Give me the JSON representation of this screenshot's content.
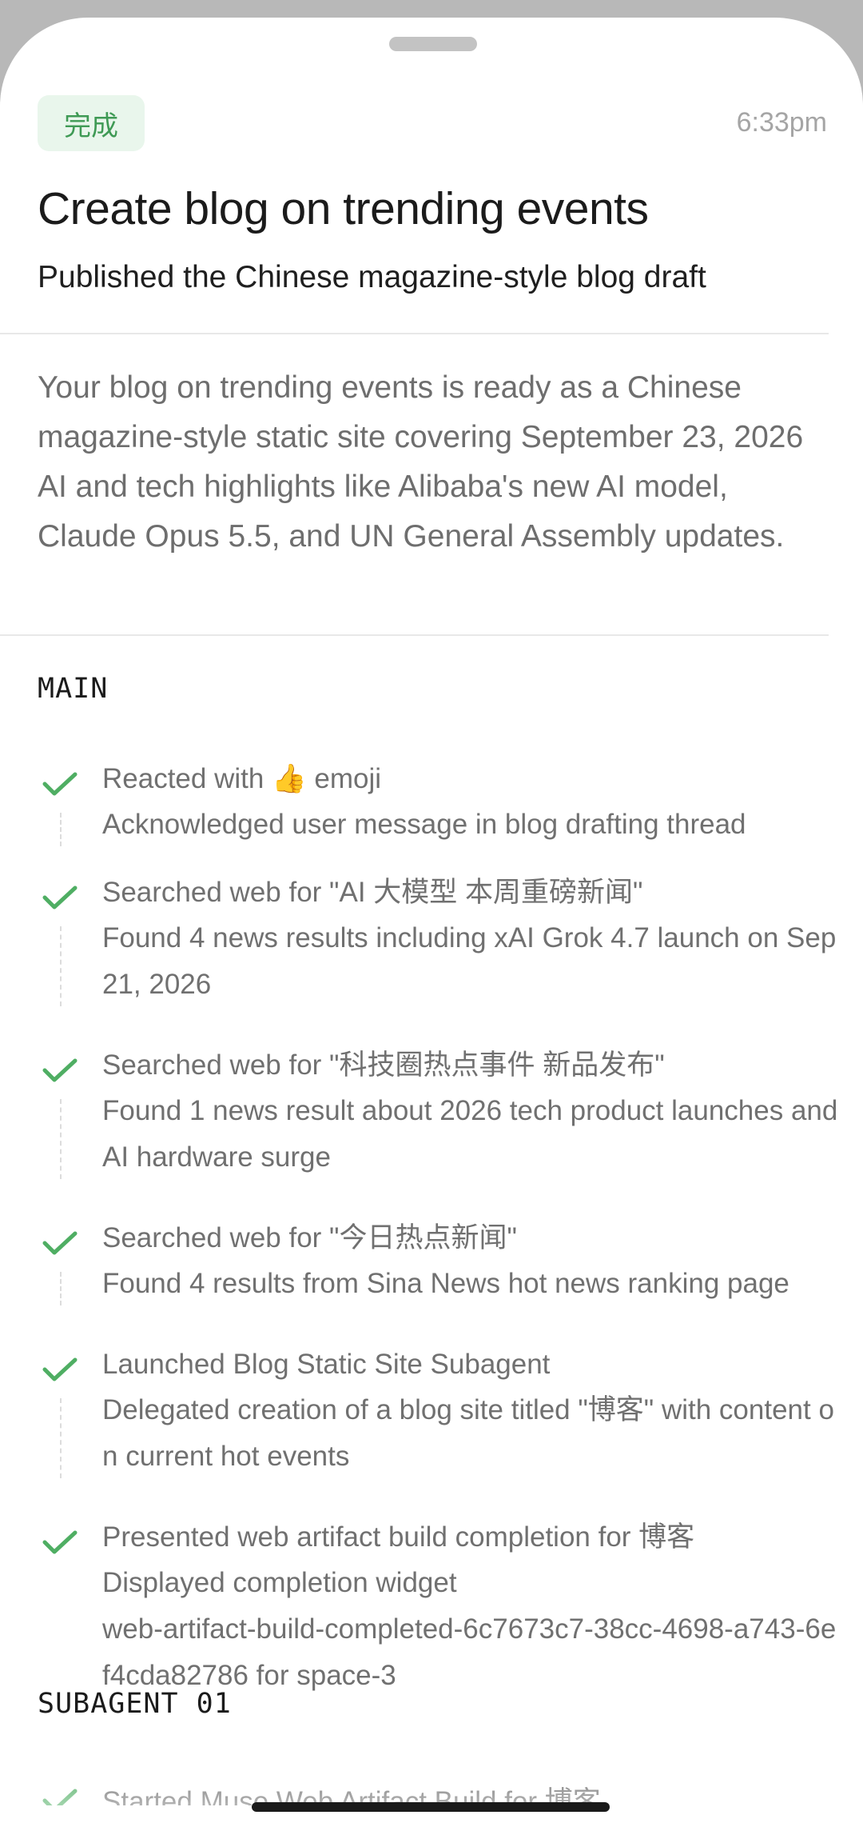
{
  "header": {
    "status_badge": "完成",
    "time": "6:33pm"
  },
  "title": "Create blog on trending events",
  "subtitle": "Published the Chinese magazine-style blog draft",
  "summary": "Your blog on trending events is ready as a Chinese magazine-style static site covering September 23, 2026 AI and tech highlights like Alibaba's new AI model, Claude Opus 5.5, and UN General Assembly updates.",
  "main_section": {
    "heading": "MAIN",
    "steps": [
      {
        "title_before": "Reacted with ",
        "emoji": "👍",
        "title_after": " emoji",
        "details": [
          "Acknowledged user message in blog drafting thread"
        ]
      },
      {
        "title": "Searched web for \"AI 大模型 本周重磅新闻\"",
        "details": [
          "Found 4 news results including xAI Grok 4.7 launch on Sep 21, 2026"
        ]
      },
      {
        "title": "Searched web for \"科技圈热点事件 新品发布\"",
        "details": [
          "Found 1 news result about 2026 tech product launches and AI hardware surge"
        ]
      },
      {
        "title": "Searched web for \"今日热点新闻\"",
        "details": [
          "Found 4 results from Sina News hot news ranking page"
        ]
      },
      {
        "title": "Launched Blog Static Site Subagent",
        "details": [
          "Delegated creation of a blog site titled \"博客\" with content on current hot events"
        ]
      },
      {
        "title": "Presented web artifact build completion for 博客",
        "details": [
          "Displayed completion widget",
          "web-artifact-build-completed-6c7673c7-38cc-4698-a743-6ef4cda82786 for space-3"
        ]
      }
    ]
  },
  "subagent_section": {
    "heading": "SUBAGENT 01",
    "steps": [
      {
        "title": "Started Muse Web Artifact Build for 博客"
      }
    ]
  },
  "colors": {
    "check": "#4fae63",
    "badge_bg": "#e9f6ec",
    "badge_text": "#3f9a55",
    "muted_text": "#707070"
  }
}
